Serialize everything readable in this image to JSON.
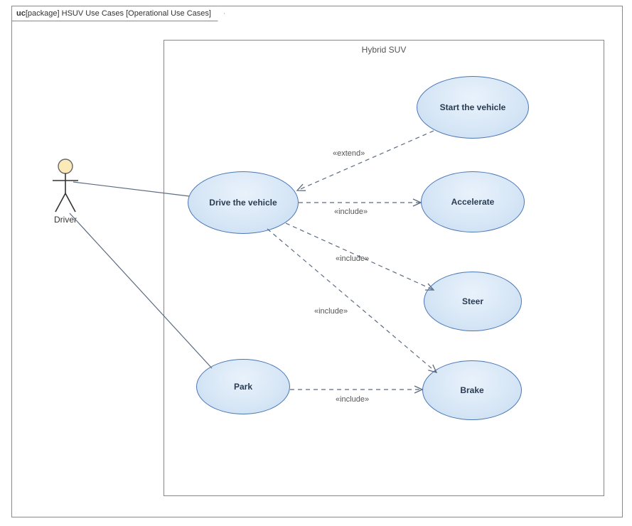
{
  "frame": {
    "prefix": "uc",
    "bracket_open": "[",
    "kind": "package",
    "bracket_close": "]",
    "name": "HSUV Use Cases",
    "subname_open": "[",
    "subname": "Operational Use Cases",
    "subname_close": "]"
  },
  "boundary": {
    "title": "Hybrid SUV"
  },
  "actor": {
    "name": "Driver"
  },
  "usecases": {
    "drive": {
      "label": "Drive the vehicle"
    },
    "park": {
      "label": "Park"
    },
    "start": {
      "label": "Start the vehicle"
    },
    "accelerate": {
      "label": "Accelerate"
    },
    "steer": {
      "label": "Steer"
    },
    "brake": {
      "label": "Brake"
    }
  },
  "relations": {
    "extend1": {
      "stereo": "«extend»"
    },
    "include1": {
      "stereo": "«include»"
    },
    "include2": {
      "stereo": "«include»"
    },
    "include3": {
      "stereo": "«include»"
    },
    "include4": {
      "stereo": "«include»"
    }
  },
  "chart_data": {
    "type": "table",
    "diagram_kind": "UML/SysML Use Case Diagram",
    "frame_header": "uc [package] HSUV Use Cases [Operational Use Cases]",
    "system_boundary": "Hybrid SUV",
    "actors": [
      "Driver"
    ],
    "use_cases": [
      "Drive the vehicle",
      "Park",
      "Start the vehicle",
      "Accelerate",
      "Steer",
      "Brake"
    ],
    "associations": [
      {
        "actor": "Driver",
        "use_case": "Drive the vehicle"
      },
      {
        "actor": "Driver",
        "use_case": "Park"
      }
    ],
    "relations": [
      {
        "from": "Start the vehicle",
        "to": "Drive the vehicle",
        "type": "extend"
      },
      {
        "from": "Drive the vehicle",
        "to": "Accelerate",
        "type": "include"
      },
      {
        "from": "Drive the vehicle",
        "to": "Steer",
        "type": "include"
      },
      {
        "from": "Drive the vehicle",
        "to": "Brake",
        "type": "include"
      },
      {
        "from": "Park",
        "to": "Brake",
        "type": "include"
      }
    ]
  }
}
